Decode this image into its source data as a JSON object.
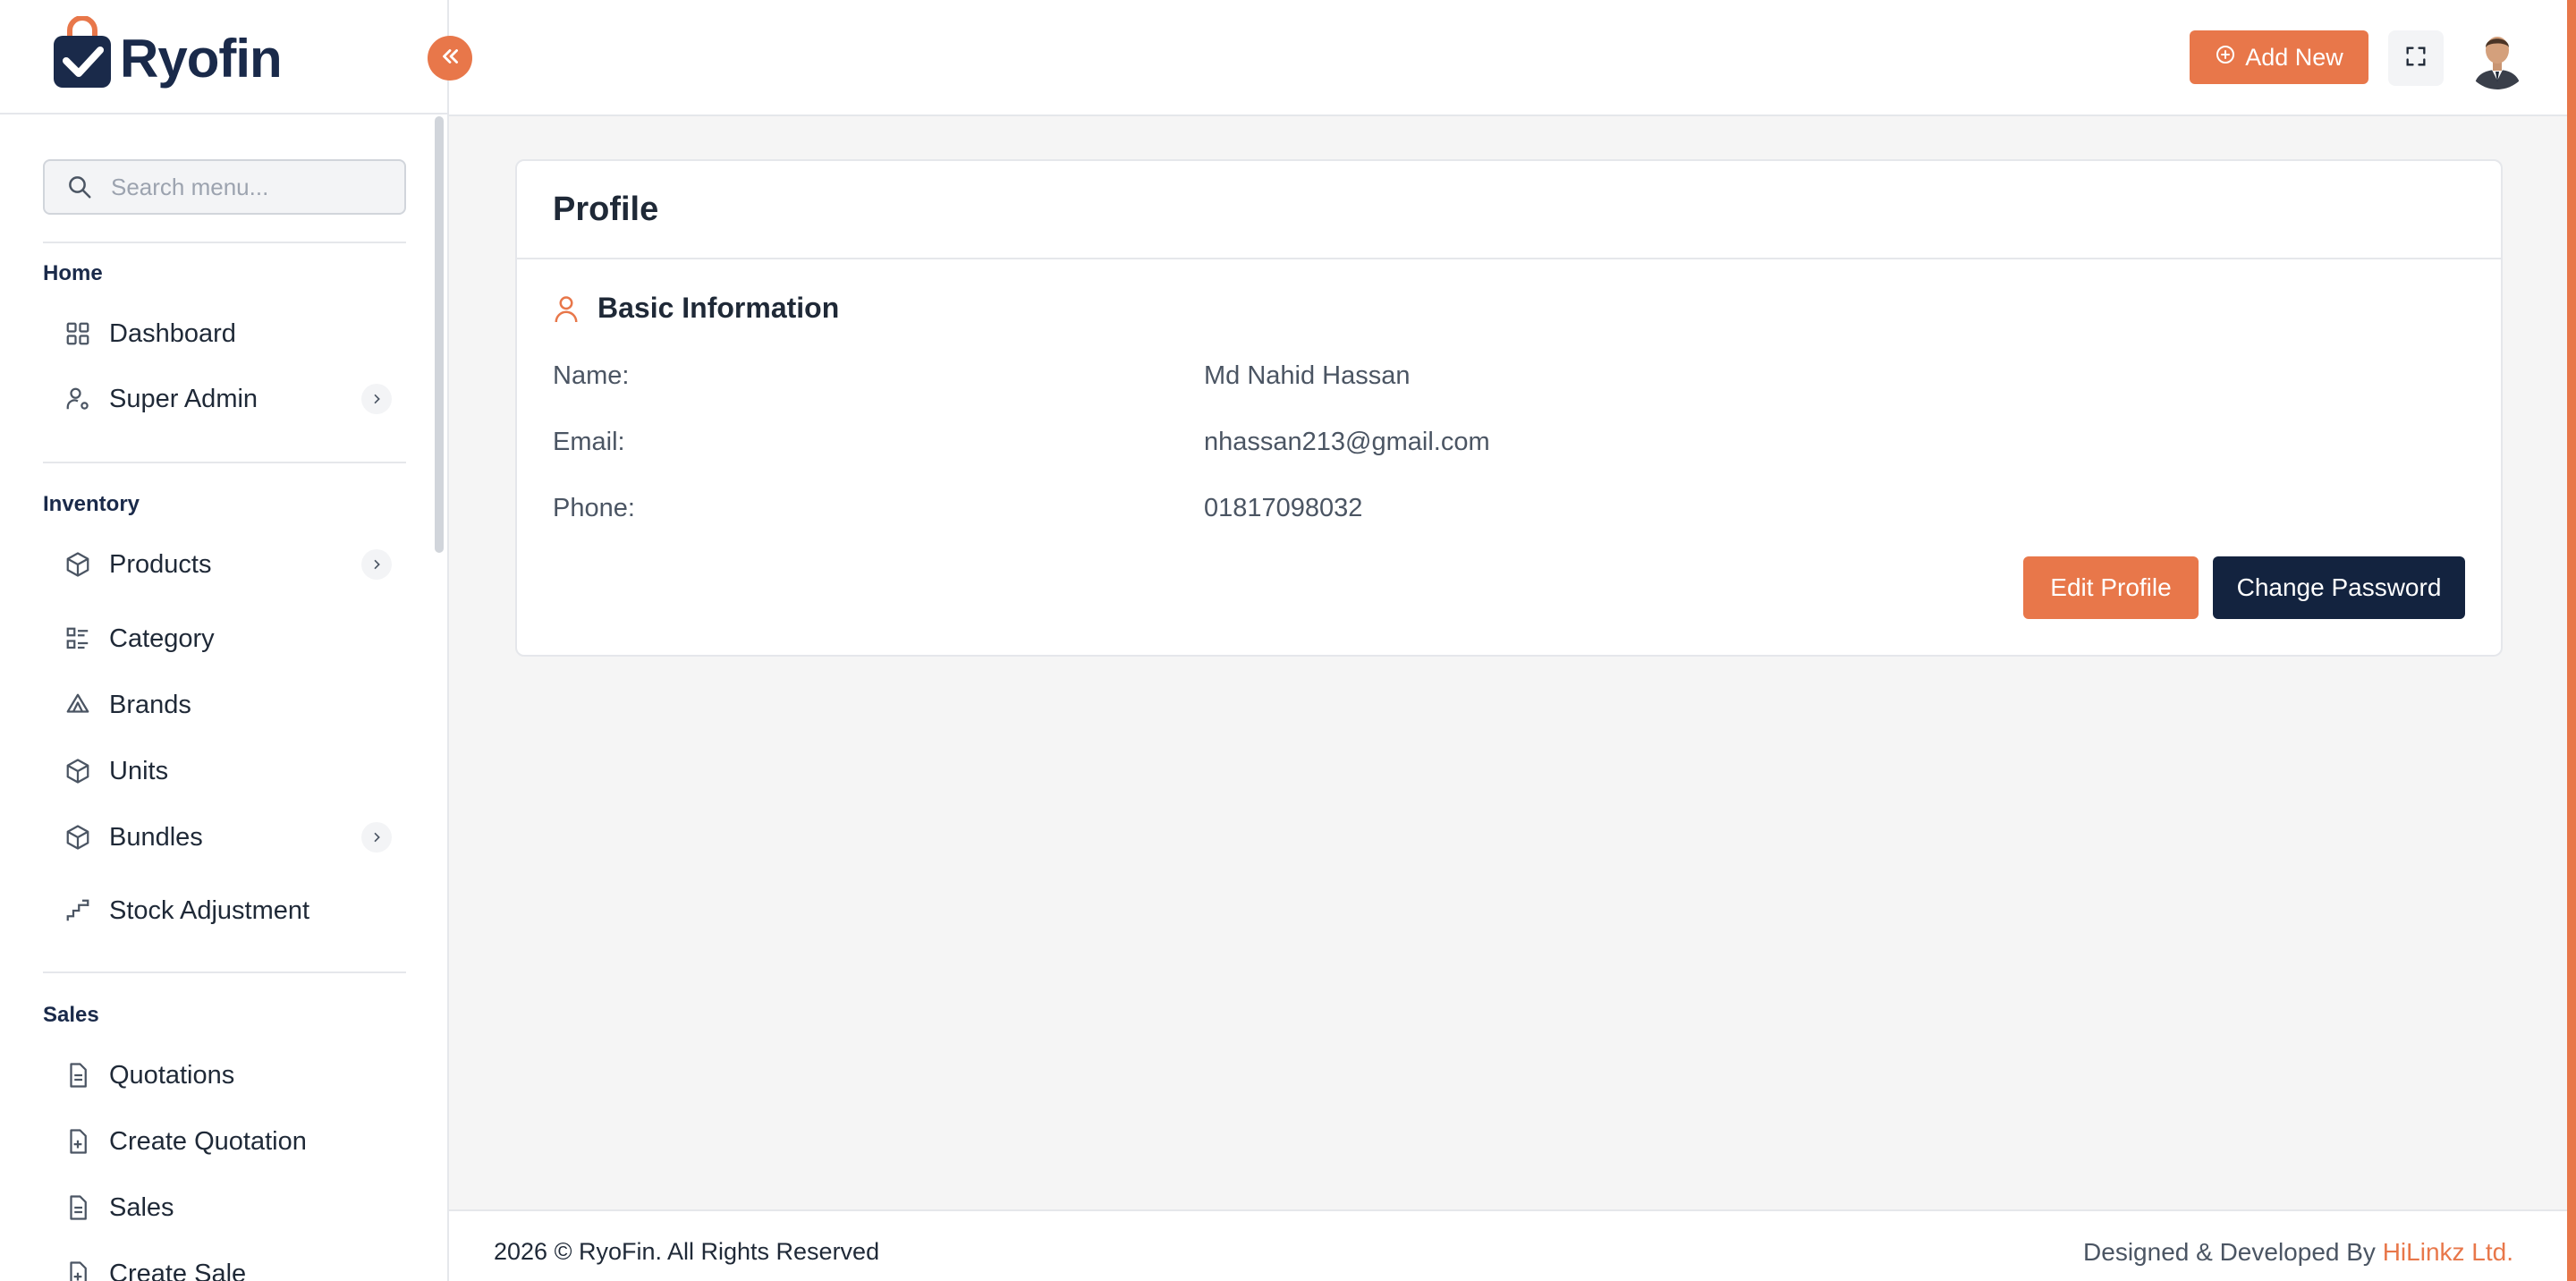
{
  "brand": {
    "name": "Ryofin"
  },
  "search": {
    "placeholder": "Search menu..."
  },
  "sidebar": {
    "sections": [
      {
        "label": "Home"
      },
      {
        "label": "Inventory"
      },
      {
        "label": "Sales"
      }
    ],
    "items": [
      {
        "label": "Dashboard",
        "icon": "grid-icon"
      },
      {
        "label": "Super Admin",
        "icon": "user-cog-icon"
      },
      {
        "label": "Products",
        "icon": "box-icon"
      },
      {
        "label": "Category",
        "icon": "list-icon"
      },
      {
        "label": "Brands",
        "icon": "tag-icon"
      },
      {
        "label": "Units",
        "icon": "box-icon"
      },
      {
        "label": "Bundles",
        "icon": "box-icon"
      },
      {
        "label": "Stock Adjustment",
        "icon": "stairs-icon"
      },
      {
        "label": "Quotations",
        "icon": "file-icon"
      },
      {
        "label": "Create Quotation",
        "icon": "file-plus-icon"
      },
      {
        "label": "Sales",
        "icon": "file-icon"
      },
      {
        "label": "Create Sale",
        "icon": "file-plus-icon"
      }
    ]
  },
  "topbar": {
    "add_new_label": "Add New"
  },
  "profile": {
    "title": "Profile",
    "section_title": "Basic Information",
    "fields": [
      {
        "label": "Name:",
        "value": "Md Nahid Hassan"
      },
      {
        "label": "Email:",
        "value": "nhassan213@gmail.com"
      },
      {
        "label": "Phone:",
        "value": "01817098032"
      }
    ],
    "edit_label": "Edit Profile",
    "password_label": "Change Password"
  },
  "footer": {
    "copyright": "2026 © RyoFin. All Rights Reserved",
    "designed_prefix": "Designed & Developed By ",
    "designed_by": "HiLinkz Ltd."
  },
  "colors": {
    "accent": "#e8774a",
    "navy": "#13233f"
  }
}
